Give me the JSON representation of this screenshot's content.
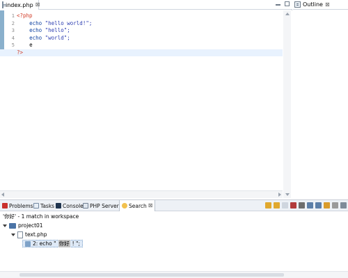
{
  "editor": {
    "tab_label": "index.php",
    "tab_close": "⊠",
    "line_numbers": [
      "1",
      "2",
      "3",
      "4",
      "5",
      "6"
    ],
    "code": {
      "l1": "<?php",
      "l2_kw": "echo",
      "l2_str": "\"hello world!\";",
      "l3_kw": "echo",
      "l3_str": "\"hello\";",
      "l4_kw": "echo",
      "l4_str": "\"world\";",
      "l5": "e",
      "l6": "?>"
    }
  },
  "outline": {
    "tab_label": "Outline",
    "tab_close": "⊠"
  },
  "bottom": {
    "tabs": {
      "problems": "Problems",
      "tasks": "Tasks",
      "console": "Console",
      "servers": "PHP Servers",
      "search": "Search",
      "search_close": "⊠"
    },
    "summary": "'你好' - 1 match in workspace",
    "tree": {
      "project": "project01",
      "file": "text.php",
      "match_prefix": "2: echo \"",
      "match_text": "你好",
      "match_suffix": "! \";"
    }
  },
  "colors": {
    "gutter_strip": "#8ab0cc",
    "php_tag": "#d23a25",
    "keyword": "#0b3fa0",
    "current_line": "#e8f2fe",
    "panel_bar": "#edf1f6"
  },
  "icons": [
    "file-icon",
    "outline-icon",
    "problems-icon",
    "tasks-icon",
    "console-icon",
    "servers-icon",
    "search-icon",
    "project-icon",
    "php-file-icon",
    "match-icon"
  ]
}
